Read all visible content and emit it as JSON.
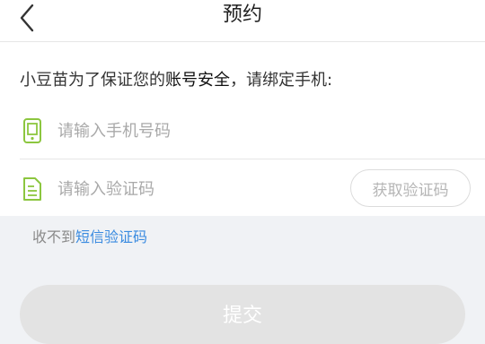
{
  "header": {
    "title": "预约",
    "back_icon": "chevron-left-icon"
  },
  "notice": {
    "prefix": "小豆苗为了保证您的",
    "emphasis": "账号安全",
    "suffix": "，请绑定手机:"
  },
  "phone_field": {
    "placeholder": "请输入手机号码",
    "value": "",
    "icon": "phone-icon"
  },
  "code_field": {
    "placeholder": "请输入验证码",
    "value": "",
    "icon": "document-icon",
    "get_code_label": "获取验证码"
  },
  "tip": {
    "prefix": "收不到",
    "link_label": "短信验证码"
  },
  "submit_label": "提交",
  "colors": {
    "accent_green": "#8cc63f",
    "link_blue": "#3a8be0",
    "disabled_button": "#e3e3e3",
    "page_background": "#f0f2f5"
  }
}
